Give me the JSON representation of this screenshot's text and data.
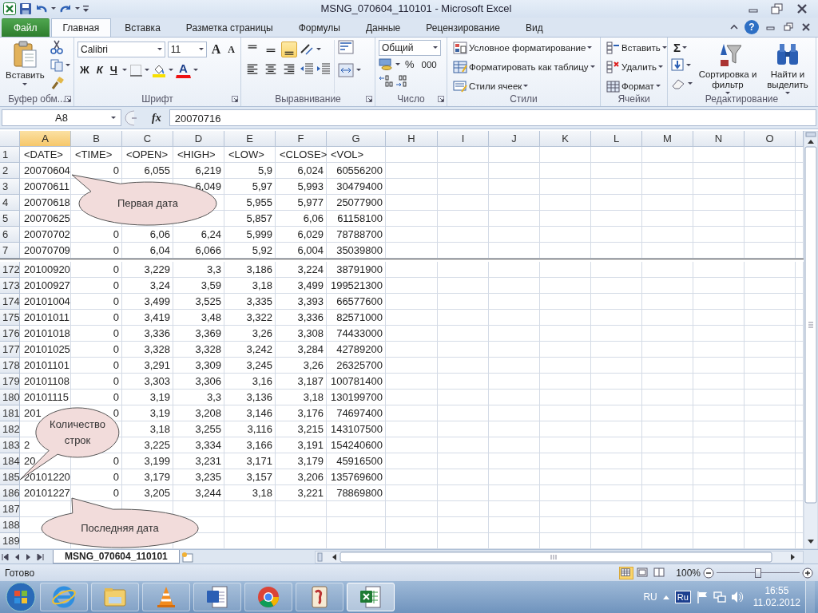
{
  "window": {
    "title": "MSNG_070604_110101  -  Microsoft Excel"
  },
  "ribbon_tabs": [
    {
      "label": "Файл",
      "kind": "file",
      "selected": false
    },
    {
      "label": "Главная",
      "kind": "tab",
      "selected": true
    },
    {
      "label": "Вставка",
      "kind": "tab",
      "selected": false
    },
    {
      "label": "Разметка страницы",
      "kind": "tab",
      "selected": false
    },
    {
      "label": "Формулы",
      "kind": "tab",
      "selected": false
    },
    {
      "label": "Данные",
      "kind": "tab",
      "selected": false
    },
    {
      "label": "Рецензирование",
      "kind": "tab",
      "selected": false
    },
    {
      "label": "Вид",
      "kind": "tab",
      "selected": false
    }
  ],
  "help": "?",
  "clipboard_group": {
    "label": "Буфер обм...",
    "paste": "Вставить"
  },
  "font_group": {
    "label": "Шрифт",
    "font_name": "Calibri",
    "font_size": "11",
    "grow": "A",
    "shrink": "A",
    "bold": "Ж",
    "italic": "К",
    "underline": "Ч",
    "font_color": "A"
  },
  "alignment_group": {
    "label": "Выравнивание",
    "vertical_buttons": [
      {
        "selected": false
      },
      {
        "selected": false
      },
      {
        "selected": true
      }
    ]
  },
  "number_group": {
    "label": "Число",
    "format": "Общий",
    "percent": "%",
    "thousands": "000"
  },
  "styles_group": {
    "label": "Стили",
    "commands": [
      "Условное форматирование",
      "Форматировать как таблицу",
      "Стили ячеек"
    ]
  },
  "cells_group": {
    "label": "Ячейки",
    "commands": [
      "Вставить",
      "Удалить",
      "Формат"
    ]
  },
  "editing_group": {
    "label": "Редактирование",
    "sum": "Σ",
    "sort": "Сортировка и фильтр",
    "find": "Найти и выделить"
  },
  "formula_bar": {
    "name_box": "A8",
    "fx": "fx",
    "value": "20070716"
  },
  "sheet": {
    "columns": [
      {
        "label": "A",
        "selected": true
      },
      {
        "label": "B",
        "selected": false
      },
      {
        "label": "C",
        "selected": false
      },
      {
        "label": "D",
        "selected": false
      },
      {
        "label": "E",
        "selected": false
      },
      {
        "label": "F",
        "selected": false
      },
      {
        "label": "G",
        "selected": false
      },
      {
        "label": "H",
        "selected": false
      },
      {
        "label": "I",
        "selected": false
      },
      {
        "label": "J",
        "selected": false
      },
      {
        "label": "K",
        "selected": false
      },
      {
        "label": "L",
        "selected": false
      },
      {
        "label": "M",
        "selected": false
      },
      {
        "label": "N",
        "selected": false
      },
      {
        "label": "O",
        "selected": false
      }
    ],
    "panes": [
      {
        "rows": [
          {
            "number": "1",
            "cells": [
              "<DATE>",
              "<TIME>",
              "<OPEN>",
              "<HIGH>",
              "<LOW>",
              "<CLOSE>",
              "<VOL>"
            ]
          },
          {
            "number": "2",
            "cells": [
              "20070604",
              "0",
              "6,055",
              "6,219",
              "5,9",
              "6,024",
              "60556200"
            ]
          },
          {
            "number": "3",
            "cells": [
              "20070611",
              null,
              null,
              "6,049",
              "5,97",
              "5,993",
              "30479400"
            ]
          },
          {
            "number": "4",
            "cells": [
              "20070618",
              null,
              null,
              null,
              "5,955",
              "5,977",
              "25077900"
            ]
          },
          {
            "number": "5",
            "cells": [
              "20070625",
              null,
              null,
              null,
              "5,857",
              "6,06",
              "61158100"
            ]
          },
          {
            "number": "6",
            "cells": [
              "20070702",
              "0",
              "6,06",
              "6,24",
              "5,999",
              "6,029",
              "78788700"
            ]
          },
          {
            "number": "7",
            "cells": [
              "20070709",
              "0",
              "6,04",
              "6,066",
              "5,92",
              "6,004",
              "35039800"
            ]
          }
        ]
      },
      {
        "rows": [
          {
            "number": "172",
            "cells": [
              "20100920",
              "0",
              "3,229",
              "3,3",
              "3,186",
              "3,224",
              "38791900"
            ]
          },
          {
            "number": "173",
            "cells": [
              "20100927",
              "0",
              "3,24",
              "3,59",
              "3,18",
              "3,499",
              "199521300"
            ]
          },
          {
            "number": "174",
            "cells": [
              "20101004",
              "0",
              "3,499",
              "3,525",
              "3,335",
              "3,393",
              "66577600"
            ]
          },
          {
            "number": "175",
            "cells": [
              "20101011",
              "0",
              "3,419",
              "3,48",
              "3,322",
              "3,336",
              "82571000"
            ]
          },
          {
            "number": "176",
            "cells": [
              "20101018",
              "0",
              "3,336",
              "3,369",
              "3,26",
              "3,308",
              "74433000"
            ]
          },
          {
            "number": "177",
            "cells": [
              "20101025",
              "0",
              "3,328",
              "3,328",
              "3,242",
              "3,284",
              "42789200"
            ]
          },
          {
            "number": "178",
            "cells": [
              "20101101",
              "0",
              "3,291",
              "3,309",
              "3,245",
              "3,26",
              "26325700"
            ]
          },
          {
            "number": "179",
            "cells": [
              "20101108",
              "0",
              "3,303",
              "3,306",
              "3,16",
              "3,187",
              "100781400"
            ]
          },
          {
            "number": "180",
            "cells": [
              "20101115",
              "0",
              "3,19",
              "3,3",
              "3,136",
              "3,18",
              "130199700"
            ]
          },
          {
            "number": "181",
            "cells": [
              "201",
              "0",
              "3,19",
              "3,208",
              "3,146",
              "3,176",
              "74697400"
            ]
          },
          {
            "number": "182",
            "cells": [
              null,
              null,
              "3,18",
              "3,255",
              "3,116",
              "3,215",
              "143107500"
            ]
          },
          {
            "number": "183",
            "cells": [
              "2",
              null,
              "3,225",
              "3,334",
              "3,166",
              "3,191",
              "154240600"
            ]
          },
          {
            "number": "184",
            "cells": [
              "20",
              "0",
              "3,199",
              "3,231",
              "3,171",
              "3,179",
              "45916500"
            ]
          },
          {
            "number": "185",
            "cells": [
              "20101220",
              "0",
              "3,179",
              "3,235",
              "3,157",
              "3,206",
              "135769600"
            ]
          },
          {
            "number": "186",
            "cells": [
              "20101227",
              "0",
              "3,205",
              "3,244",
              "3,18",
              "3,221",
              "78869800"
            ]
          },
          {
            "number": "187"
          },
          {
            "number": "188"
          },
          {
            "number": "189"
          }
        ]
      }
    ]
  },
  "callouts": [
    {
      "text": "Первая дата"
    },
    {
      "text": "Количество строк"
    },
    {
      "text": "Последняя дата"
    }
  ],
  "sheet_tabs": [
    {
      "label": "MSNG_070604_110101",
      "selected": true
    }
  ],
  "status_bar": {
    "status": "Готово",
    "views": [
      {
        "selected": true
      },
      {
        "selected": false
      },
      {
        "selected": false
      }
    ],
    "zoom": "100%",
    "zoom_slider": {
      "level": 0.5
    }
  },
  "taskbar": {
    "apps": [
      {
        "selected": false
      },
      {
        "selected": false
      },
      {
        "selected": false
      },
      {
        "selected": false
      },
      {
        "selected": false
      },
      {
        "selected": false
      },
      {
        "selected": true
      }
    ],
    "language": "RU",
    "input_indicator": "Ru",
    "time": "16:55",
    "date": "11.02.2012"
  }
}
